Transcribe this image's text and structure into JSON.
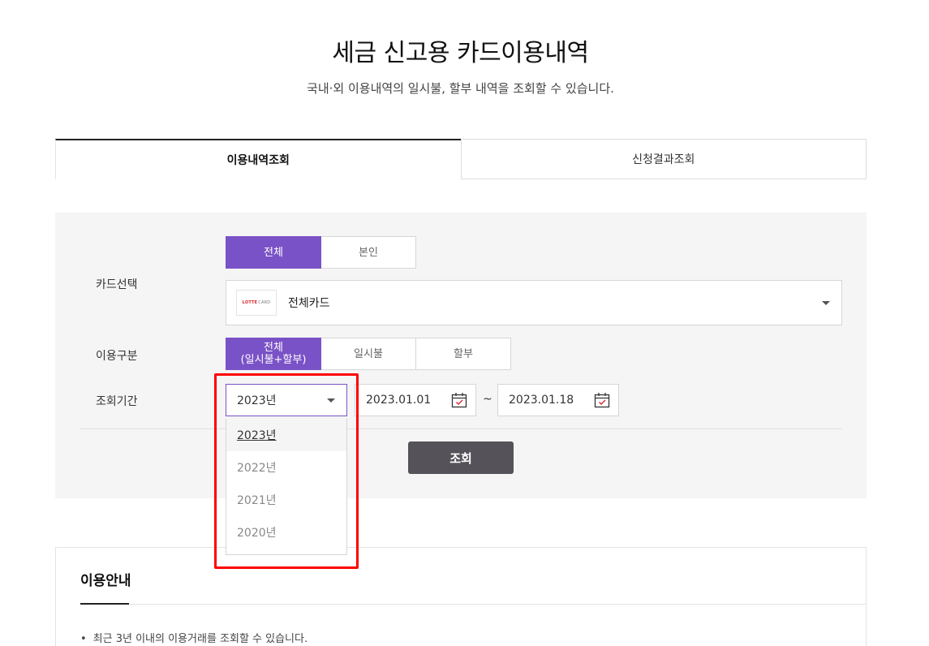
{
  "header": {
    "title": "세금 신고용 카드이용내역",
    "subtitle": "국내·외 이용내역의 일시불, 할부 내역을 조회할 수 있습니다."
  },
  "tabs": [
    {
      "label": "이용내역조회",
      "active": true
    },
    {
      "label": "신청결과조회",
      "active": false
    }
  ],
  "form": {
    "card_label": "카드선택",
    "owner_options": [
      {
        "label": "전체",
        "selected": true
      },
      {
        "label": "본인",
        "selected": false
      }
    ],
    "card_select": {
      "logo_text": "LOTTE",
      "logo_subtext": "CARD",
      "value": "전체카드"
    },
    "usage_label": "이용구분",
    "usage_options": [
      {
        "label": "전체",
        "sublabel": "(일시불+할부)",
        "selected": true
      },
      {
        "label": "일시불",
        "selected": false
      },
      {
        "label": "할부",
        "selected": false
      }
    ],
    "period_label": "조회기간",
    "year_select": {
      "value": "2023년",
      "options": [
        "2023년",
        "2022년",
        "2021년",
        "2020년"
      ]
    },
    "start_date": "2023.01.01",
    "date_separator": "~",
    "end_date": "2023.01.18",
    "search_button": "조회"
  },
  "info": {
    "title": "이용안내",
    "items": [
      "최근 3년 이내의 이용거래를 조회할 수 있습니다."
    ]
  },
  "colors": {
    "accent": "#7a52c7",
    "button_dark": "#555259",
    "highlight": "#ff0000",
    "card_logo": "#d7262e"
  }
}
